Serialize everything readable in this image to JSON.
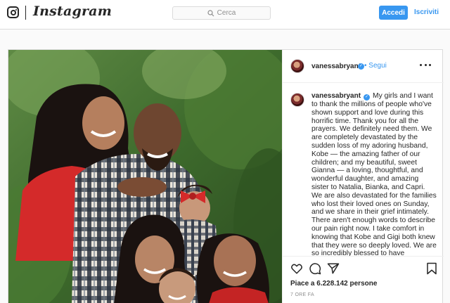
{
  "nav": {
    "brand": "Instagram",
    "search_placeholder": "Cerca",
    "login_label": "Accedi",
    "signup_label": "Iscriviti"
  },
  "post": {
    "username": "vanessabryant",
    "follow_label": "• Segui",
    "caption": "My girls and I want to thank the millions of people who've shown support and love during this horrific time. Thank you for all the prayers. We definitely need them. We are completely devastated by the sudden loss of my adoring husband, Kobe — the amazing father of our children; and my beautiful, sweet Gianna — a loving, thoughtful, and wonderful daughter, and amazing sister to Natalia, Bianka, and Capri. We are also devastated for the families who lost their loved ones on Sunday, and we share in their grief intimately. There aren't enough words to describe our pain right now. I take comfort in knowing that Kobe and Gigi both knew that they were so deeply loved. We are so incredibly blessed to have",
    "likes": "Piace a 6.228.142 persone",
    "timestamp": "7 ORE FA"
  },
  "colors": {
    "accent": "#3897f0",
    "border": "#dbdbdb",
    "text": "#262626",
    "muted": "#8e8e8e"
  },
  "icons": {
    "brand_glyph": "instagram-camera-icon",
    "search": "search-icon",
    "verified": "verified-badge-icon",
    "more": "more-options-icon",
    "like": "heart-icon",
    "comment": "comment-icon",
    "share": "paper-plane-icon",
    "save": "bookmark-icon"
  }
}
